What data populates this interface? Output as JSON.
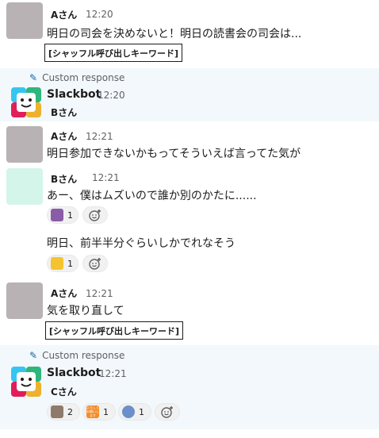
{
  "messages": [
    {
      "user": "Aさん",
      "time": "12:20",
      "text": "明日の司会を決めないと！明日の読書会の司会は...",
      "keyword": "[シャッフル呼び出しキーワード]"
    },
    {
      "label": "Custom response",
      "bot_name": "Slackbot",
      "time": "12:20",
      "text": "Bさん"
    },
    {
      "user": "Aさん",
      "time": "12:21",
      "text": "明日参加できないかもってそういえば言ってた気が"
    },
    {
      "user": "Bさん",
      "time": "12:21",
      "text": "あー、僕はムズいので誰か別のかたに......",
      "reaction_count": "1"
    },
    {
      "text": "明日、前半半分ぐらいしかでれなそう",
      "reaction_count": "1"
    },
    {
      "user": "Aさん",
      "time": "12:21",
      "text": "気を取り直して",
      "keyword": "[シャッフル呼び出しキーワード]"
    },
    {
      "label": "Custom response",
      "bot_name": "Slackbot",
      "time": "12:21",
      "text": "Cさん",
      "reactions": [
        {
          "count": "2",
          "icon": "cat-emoji"
        },
        {
          "count": "1",
          "icon": "yoroshiku-emoji",
          "emoji_text": "よろしくお願いします"
        },
        {
          "count": "1",
          "icon": "person-emoji"
        }
      ]
    }
  ],
  "colors": {
    "highlight_bg": "#f2f8fc",
    "link_blue": "#1264a3",
    "muted": "#616061"
  }
}
